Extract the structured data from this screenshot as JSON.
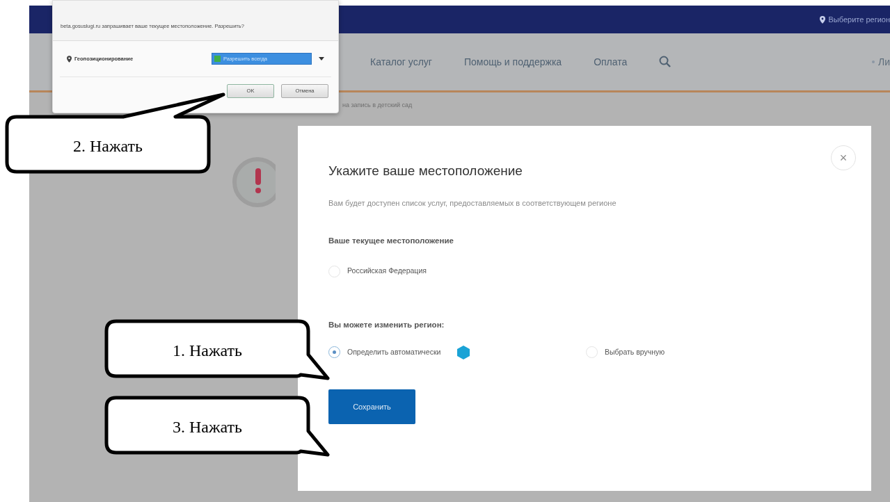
{
  "top_bar": {
    "region_link": "Выберите регион"
  },
  "nav": {
    "items": [
      "Каталог услуг",
      "Помощь и поддержка",
      "Оплата"
    ],
    "cut_item": "Ли"
  },
  "breadcrumb": "на запись в детский сад",
  "browser_prompt": {
    "message": "beta.gosuslugi.ru запрашивает ваше текущее местоположение. Разрешить?",
    "permission": "Геопозиционирование",
    "choice": {
      "label": "Разрешить всегда",
      "checked": true
    },
    "buttons": [
      "OK",
      "Отмена"
    ]
  },
  "modal": {
    "close_button": "×",
    "title": "Укажите ваше местоположение",
    "description": "Вам будет доступен список услуг, предоставляемых в соответствующем регионе",
    "current_heading": "Ваше текущее местоположение",
    "current_options": [
      {
        "label": "Российская Федерация",
        "selected": false
      }
    ],
    "change_heading": "Вы можете изменить регион:",
    "change_options": [
      {
        "label": "Определить автоматически",
        "selected": true,
        "busy": true
      },
      {
        "label": "Выбрать вручную",
        "selected": false,
        "busy": false
      }
    ],
    "save_button": "Сохранить"
  },
  "callouts": [
    {
      "label": "2. Нажать"
    },
    {
      "label": "1. Нажать"
    },
    {
      "label": "3. Нажать"
    }
  ]
}
